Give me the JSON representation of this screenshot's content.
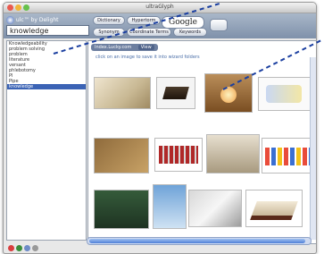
{
  "window": {
    "title": "ultraGlyph"
  },
  "toolbar": {
    "logo": "ulc™ by Delight",
    "buttons": {
      "dictionary": "Dictionary",
      "hypertorm": "Hypertorm",
      "synonym": "Synonym",
      "coordinate_terms": "Coordinate Terms",
      "keywords": "Keywords"
    },
    "google": "Google"
  },
  "search": {
    "value": "knowledge"
  },
  "sidebar": {
    "items": [
      "Knowledgeability",
      "problem solving",
      "problem",
      "literature",
      "versant",
      "phlebotomy",
      "Pl",
      "Pipe",
      "knowledge"
    ],
    "selected_index": 8
  },
  "main": {
    "subbar_label": "Index.Lucky.com",
    "subbar_button": "View",
    "hint": "click on an image to save it into wizard folders"
  },
  "images": [
    {
      "name": "scroll-image"
    },
    {
      "name": "books-image"
    },
    {
      "name": "lab-flask-image"
    },
    {
      "name": "old-page-image"
    },
    {
      "name": "book-spines-image"
    },
    {
      "name": "open-book-image"
    },
    {
      "name": "people-icons-image"
    },
    {
      "name": "teacher-image"
    },
    {
      "name": "statue-image"
    },
    {
      "name": "pen-image"
    },
    {
      "name": "closed-book-image"
    }
  ],
  "colors": {
    "accent": "#3b63b5",
    "toolbar": "#8c9db4",
    "arrow": "#1b3fa0"
  }
}
